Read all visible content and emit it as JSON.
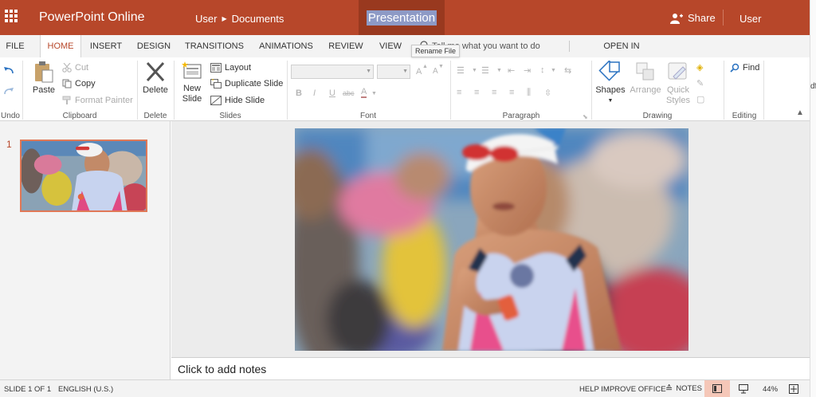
{
  "app": {
    "name": "PowerPoint Online",
    "breadcrumb_owner": "User",
    "breadcrumb_folder": "Documents",
    "document_title": "Presentation",
    "share_label": "Share",
    "user_label": "User",
    "brand_color": "#b7472a"
  },
  "tabs": {
    "file": "FILE",
    "home": "HOME",
    "insert": "INSERT",
    "design": "DESIGN",
    "transitions": "TRANSITIONS",
    "animations": "ANIMATIONS",
    "review": "REVIEW",
    "view": "VIEW",
    "tell_me": "Tell me what you want to do",
    "open_in_app": "OPEN IN POWERPOINT",
    "active": "HOME"
  },
  "tooltip": "Rename File",
  "ribbon": {
    "undo_group": "Undo",
    "clipboard": {
      "paste": "Paste",
      "cut": "Cut",
      "copy": "Copy",
      "format_painter": "Format Painter",
      "label": "Clipboard"
    },
    "delete": {
      "button": "Delete",
      "label": "Delete"
    },
    "slides": {
      "new_slide_1": "New",
      "new_slide_2": "Slide",
      "layout": "Layout",
      "duplicate": "Duplicate Slide",
      "hide": "Hide Slide",
      "label": "Slides"
    },
    "font": {
      "grow": "A",
      "shrink": "A",
      "bold": "B",
      "italic": "I",
      "underline": "U",
      "strikethrough": "abc",
      "font_color": "A",
      "label": "Font"
    },
    "paragraph": {
      "label": "Paragraph"
    },
    "drawing": {
      "shapes": "Shapes",
      "arrange": "Arrange",
      "quick_styles_1": "Quick",
      "quick_styles_2": "Styles",
      "label": "Drawing"
    },
    "editing": {
      "find": "Find",
      "label": "Editing"
    }
  },
  "slides_pane": {
    "slide_number": "1"
  },
  "right_edge_letter": "df",
  "notes_placeholder": "Click to add notes",
  "status": {
    "slide_info": "SLIDE 1 OF 1",
    "language": "ENGLISH (U.S.)",
    "help": "HELP IMPROVE OFFICE",
    "notes": "NOTES",
    "zoom": "44%"
  }
}
